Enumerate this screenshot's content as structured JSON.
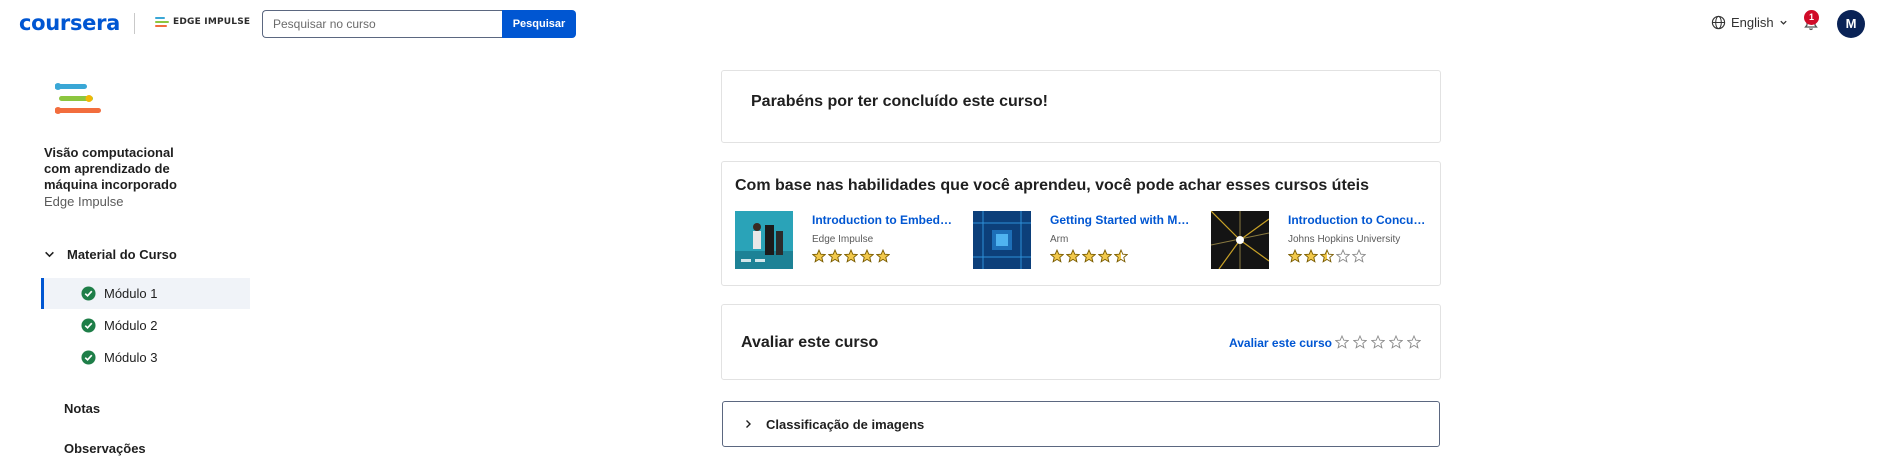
{
  "header": {
    "logo_text": "coursera",
    "partner_name": "EDGE IMPULSE",
    "search_placeholder": "Pesquisar no curso",
    "search_button": "Pesquisar",
    "language": "English",
    "notification_count": "1",
    "avatar_initial": "M"
  },
  "sidebar": {
    "course_title": "Visão computacional com aprendizado de máquina incorporado",
    "course_partner": "Edge Impulse",
    "material_label": "Material do Curso",
    "modules": [
      {
        "label": "Módulo 1",
        "active": true,
        "completed": true
      },
      {
        "label": "Módulo 2",
        "active": false,
        "completed": true
      },
      {
        "label": "Módulo 3",
        "active": false,
        "completed": true
      }
    ],
    "notes_label": "Notas",
    "observations_label": "Observações"
  },
  "main": {
    "congrats_text": "Parabéns por ter concluído este curso!",
    "recommendations_title": "Com base nas habilidades que você aprendeu, você pode achar esses cursos úteis",
    "recommendations": [
      {
        "title": "Introduction to Embed…",
        "partner": "Edge Impulse",
        "rating": 5
      },
      {
        "title": "Getting Started with M…",
        "partner": "Arm",
        "rating": 4.5
      },
      {
        "title": "Introduction to Concur…",
        "partner": "Johns Hopkins University",
        "rating": 2.5
      }
    ],
    "rate_title": "Avaliar este curso",
    "rate_link": "Avaliar este curso",
    "accordion_label": "Classificação de imagens"
  },
  "colors": {
    "brand_blue": "#0056d2",
    "star_gold": "#f2c94c",
    "completed_green": "#1e7e48",
    "badge_red": "#d00b28"
  }
}
